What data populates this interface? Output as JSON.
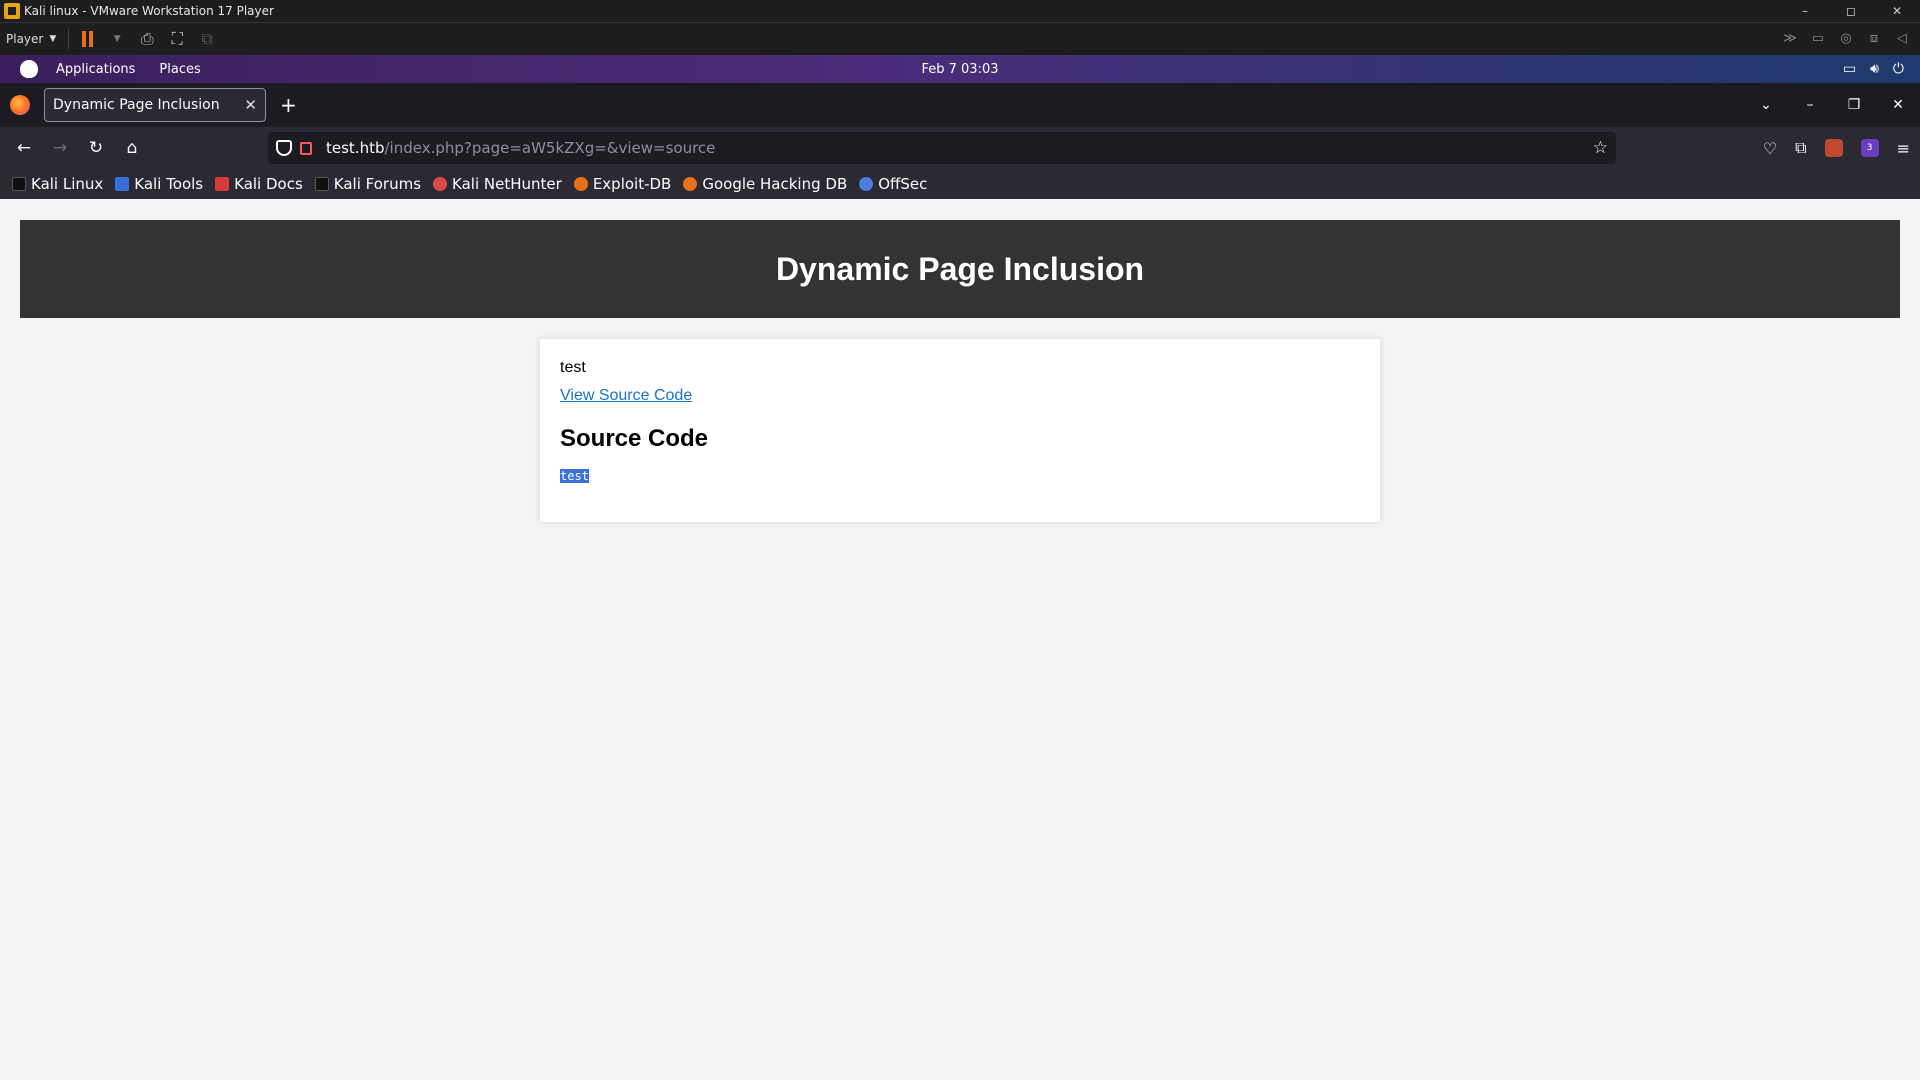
{
  "vmware": {
    "title": "Kali linux - VMware Workstation 17 Player",
    "player_menu": "Player",
    "window_controls": [
      "–",
      "◻",
      "✕"
    ]
  },
  "kali_panel": {
    "applications": "Applications",
    "places": "Places",
    "clock": "Feb 7  03:03"
  },
  "browser": {
    "tab_title": "Dynamic Page Inclusion",
    "url_host": "test.htb",
    "url_path": "/index.php?page=aW5kZXg=&view=source",
    "extension_badge": "3",
    "bookmarks": [
      "Kali Linux",
      "Kali Tools",
      "Kali Docs",
      "Kali Forums",
      "Kali NetHunter",
      "Exploit-DB",
      "Google Hacking DB",
      "OffSec"
    ]
  },
  "page": {
    "header": "Dynamic Page Inclusion",
    "content_text": "test",
    "view_source_link": "View Source Code",
    "source_heading": "Source Code",
    "source_code": "test"
  }
}
